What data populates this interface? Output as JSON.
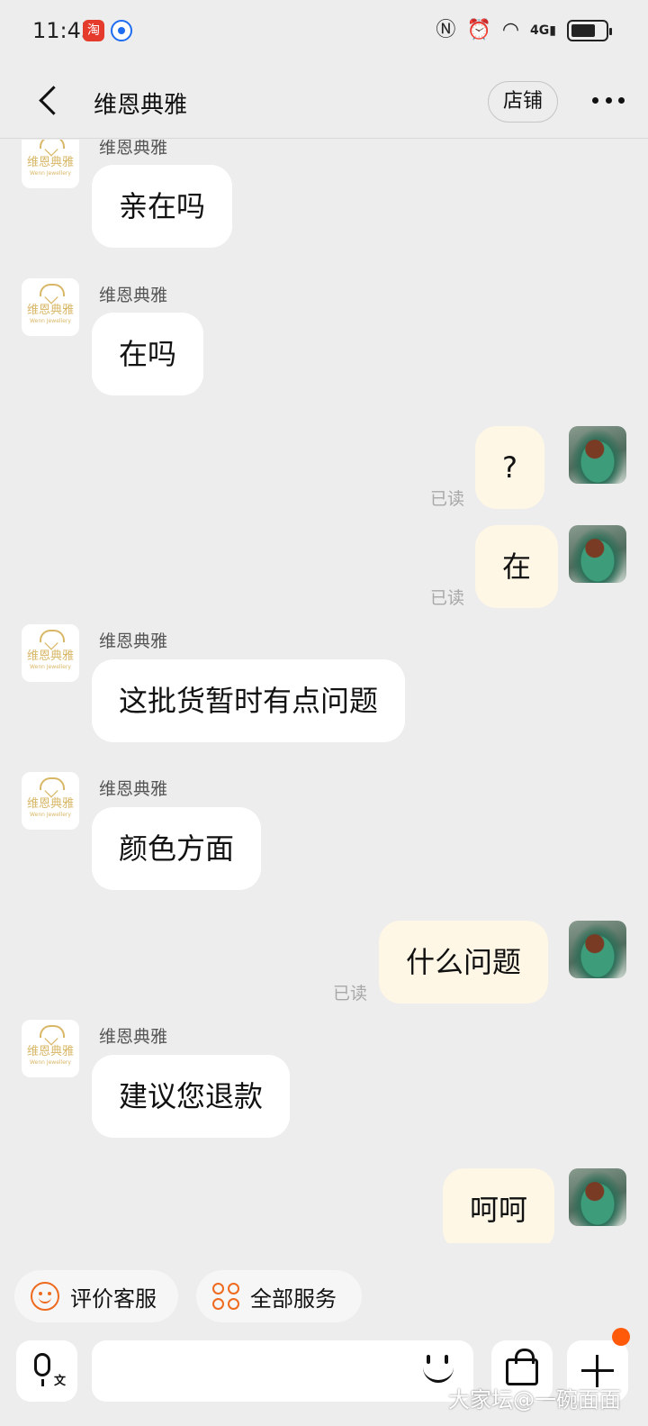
{
  "status_bar": {
    "time": "11:43",
    "taobao_badge": "淘",
    "icons": [
      "nfc-icon",
      "alarm-icon",
      "wifi-icon",
      "signal-4g-icon",
      "battery-icon"
    ],
    "network": "4G"
  },
  "header": {
    "title": "维恩典雅",
    "shop_button": "店铺"
  },
  "shop_avatar": {
    "logo_text": "维恩典雅",
    "logo_sub": "Wenn Jewellery"
  },
  "messages": [
    {
      "side": "in",
      "sender": "维恩典雅",
      "text": "亲在吗"
    },
    {
      "side": "in",
      "sender": "维恩典雅",
      "text": "在吗"
    },
    {
      "side": "out",
      "text": "?",
      "status": "已读"
    },
    {
      "side": "out",
      "text": "在",
      "status": "已读"
    },
    {
      "side": "in",
      "sender": "维恩典雅",
      "text": "这批货暂时有点问题"
    },
    {
      "side": "in",
      "sender": "维恩典雅",
      "text": "颜色方面"
    },
    {
      "side": "out",
      "text": "什么问题",
      "status": "已读"
    },
    {
      "side": "in",
      "sender": "维恩典雅",
      "text": "建议您退款"
    },
    {
      "side": "out",
      "text": "呵呵"
    }
  ],
  "quick_actions": {
    "rate_service": "评价客服",
    "all_services": "全部服务"
  },
  "input": {
    "placeholder": "",
    "voice_sub": "文"
  },
  "watermark": "大家坛@一碗面面",
  "colors": {
    "background": "#ededed",
    "incoming_bubble": "#ffffff",
    "outgoing_bubble": "#fff7e6",
    "accent": "#ee6a1e",
    "logo_gold": "#d8b766"
  }
}
